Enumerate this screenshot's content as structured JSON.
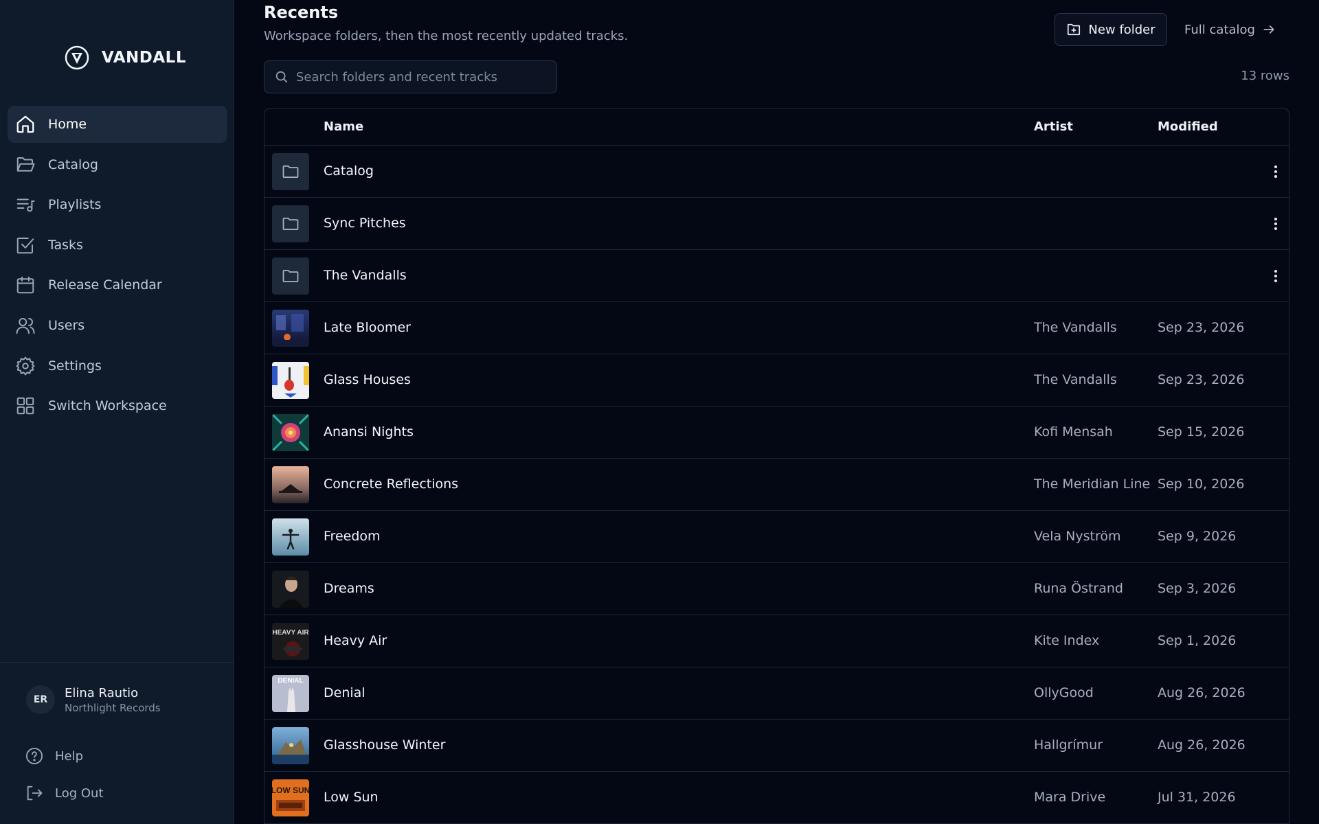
{
  "brand": {
    "name": "VANDALL"
  },
  "sidebar": {
    "items": [
      {
        "label": "Home",
        "icon": "home-icon",
        "active": true
      },
      {
        "label": "Catalog",
        "icon": "folder-open-icon"
      },
      {
        "label": "Playlists",
        "icon": "playlist-icon"
      },
      {
        "label": "Tasks",
        "icon": "checkbox-icon"
      },
      {
        "label": "Release Calendar",
        "icon": "calendar-icon"
      },
      {
        "label": "Users",
        "icon": "users-icon"
      },
      {
        "label": "Settings",
        "icon": "gear-icon"
      },
      {
        "label": "Switch Workspace",
        "icon": "grid-icon"
      }
    ],
    "user": {
      "initials": "ER",
      "name": "Elina Rautio",
      "org": "Northlight Records"
    },
    "help_label": "Help",
    "logout_label": "Log Out"
  },
  "main": {
    "title": "Recents",
    "subtitle": "Workspace folders, then the most recently updated tracks.",
    "new_folder_label": "New folder",
    "full_catalog_label": "Full catalog",
    "search_placeholder": "Search folders and recent tracks",
    "row_count": "13 rows",
    "columns": {
      "name": "Name",
      "artist": "Artist",
      "modified": "Modified"
    },
    "rows": [
      {
        "type": "folder",
        "name": "Catalog",
        "artist": "",
        "modified": ""
      },
      {
        "type": "folder",
        "name": "Sync Pitches",
        "artist": "",
        "modified": ""
      },
      {
        "type": "folder",
        "name": "The Vandalls",
        "artist": "",
        "modified": ""
      },
      {
        "type": "track",
        "name": "Late Bloomer",
        "artist": "The Vandalls",
        "modified": "Sep 23, 2026"
      },
      {
        "type": "track",
        "name": "Glass Houses",
        "artist": "The Vandalls",
        "modified": "Sep 23, 2026"
      },
      {
        "type": "track",
        "name": "Anansi Nights",
        "artist": "Kofi Mensah",
        "modified": "Sep 15, 2026"
      },
      {
        "type": "track",
        "name": "Concrete Reflections",
        "artist": "The Meridian Line",
        "modified": "Sep 10, 2026"
      },
      {
        "type": "track",
        "name": "Freedom",
        "artist": "Vela Nyström",
        "modified": "Sep 9, 2026"
      },
      {
        "type": "track",
        "name": "Dreams",
        "artist": "Runa Östrand",
        "modified": "Sep 3, 2026"
      },
      {
        "type": "track",
        "name": "Heavy Air",
        "artist": "Kite Index",
        "modified": "Sep 1, 2026",
        "cover_text": "HEAVY AIR"
      },
      {
        "type": "track",
        "name": "Denial",
        "artist": "OllyGood",
        "modified": "Aug 26, 2026",
        "cover_text": "DENIAL"
      },
      {
        "type": "track",
        "name": "Glasshouse Winter",
        "artist": "Hallgrímur",
        "modified": "Aug 26, 2026"
      },
      {
        "type": "track",
        "name": "Low Sun",
        "artist": "Mara Drive",
        "modified": "Jul 31, 2026",
        "cover_text": "LOW SUN"
      }
    ]
  }
}
